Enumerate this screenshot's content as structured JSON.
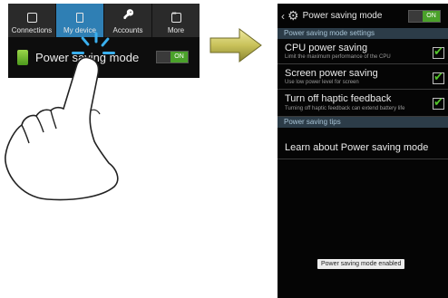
{
  "left_screen": {
    "tabs": [
      {
        "label": "Connections",
        "icon": "connections-icon",
        "active": false
      },
      {
        "label": "My device",
        "icon": "device-icon",
        "active": true
      },
      {
        "label": "Accounts",
        "icon": "key-icon",
        "active": false
      },
      {
        "label": "More",
        "icon": "more-icon",
        "active": false
      }
    ],
    "row_label": "Power saving mode",
    "toggle": "ON"
  },
  "right_screen": {
    "title": "Power saving mode",
    "toggle": "ON",
    "settings_header": "Power saving mode settings",
    "items": [
      {
        "title": "CPU power saving",
        "subtitle": "Limit the maximum performance of the CPU",
        "checked": true
      },
      {
        "title": "Screen power saving",
        "subtitle": "Use low power level for screen",
        "checked": true
      },
      {
        "title": "Turn off haptic feedback",
        "subtitle": "Turning off haptic feedback can extend battery life",
        "checked": true
      }
    ],
    "tips_header": "Power saving tips",
    "learn": "Learn about Power saving mode",
    "toast": "Power saving mode enabled"
  },
  "colors": {
    "accent": "#2f7fb4",
    "toggle_on": "#4aa12a",
    "checkmark": "#53c32a",
    "arrow": "#c9c25a"
  }
}
